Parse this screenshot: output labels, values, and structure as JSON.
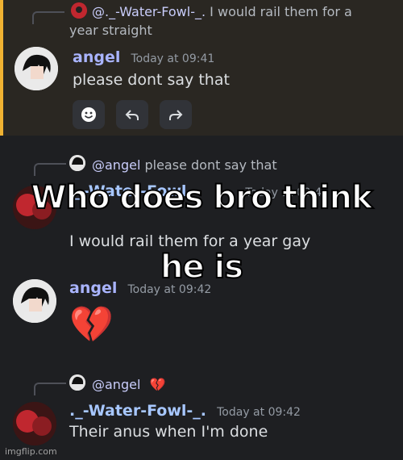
{
  "top": {
    "reply": {
      "mention": "@._-Water-Fowl-_.",
      "text_line1": "I would rail them for a",
      "text_line2": "year straight"
    },
    "author": "angel",
    "time": "Today at 09:41",
    "content": "please dont say that"
  },
  "msg1": {
    "reply": {
      "mention": "@angel",
      "text": "please dont say that"
    },
    "author_partial": "._-Water-Fowl-",
    "time_partial": "Today at 09:4",
    "content": "I would rail them for a year gay"
  },
  "msg2": {
    "author": "angel",
    "time": "Today at 09:42",
    "emoji": "💔"
  },
  "msg3": {
    "reply": {
      "mention": "@angel",
      "emoji": "💔"
    },
    "author": "._-Water-Fowl-_.",
    "time": "Today at 09:42",
    "content": "Their anus when I'm done"
  },
  "overlay": {
    "line1": "Who does bro think",
    "line2": "he is"
  },
  "watermark": "imgflip.com",
  "colors": {
    "accent": "#f0b232",
    "name_angel": "#a9b4ff",
    "name_fowl": "#a7c7ff"
  }
}
